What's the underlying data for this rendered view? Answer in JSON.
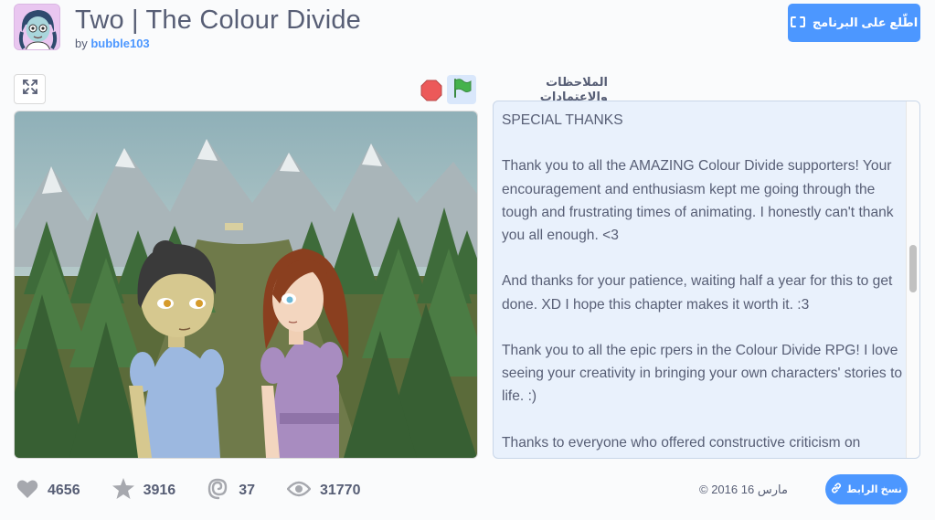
{
  "project": {
    "title": "Two | The Colour Divide",
    "by_label": "by",
    "author": "bubble103"
  },
  "header": {
    "see_inside_label": "اطّلع على البرنامج"
  },
  "controls": {
    "fullscreen_icon": "fullscreen-icon",
    "stop_icon": "stop-sign-icon",
    "flag_icon": "green-flag-icon"
  },
  "notes": {
    "label": "الملاحظات والإعتمادات",
    "text": "SPECIAL THANKS\n\nThank you to all the AMAZING Colour Divide supporters! Your encouragement and enthusiasm kept me going through the tough and frustrating times of animating. I honestly can't thank you all enough. <3\n\nAnd thanks for your patience, waiting half a year for this to get done. XD I hope this chapter makes it worth it. :3\n\nThank you to all the epic rpers in the Colour Divide RPG! I love seeing your creativity in bringing your own characters' stories to life. :)\n\nThanks to everyone who offered constructive criticism on"
  },
  "stats": {
    "loves": "4656",
    "favorites": "3916",
    "remixes": "37",
    "views": "31770"
  },
  "footer": {
    "date": "مارس 16 2016 ©",
    "copy_link_label": "نسخ الرابط"
  },
  "colors": {
    "accent": "#4c97ff",
    "text": "#575e75",
    "notes_bg": "#e9f1fc",
    "stop": "#ec5959",
    "flag": "#45b24d"
  }
}
